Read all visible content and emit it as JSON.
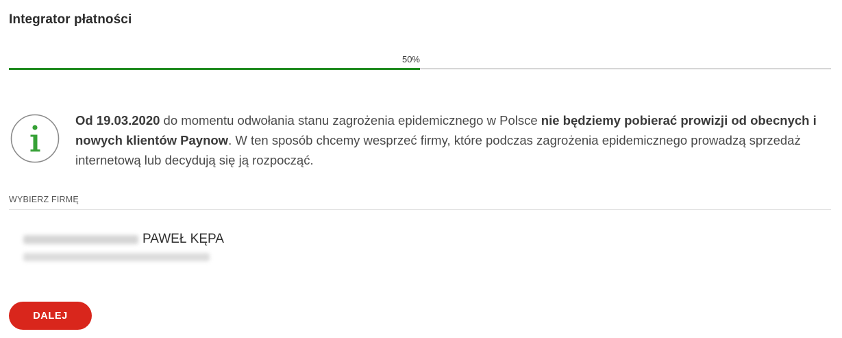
{
  "page": {
    "title": "Integrator płatności"
  },
  "progress": {
    "label": "50%",
    "value": 0.5,
    "fill_color": "#1e8a1e",
    "track_color": "#9a9a9a"
  },
  "notice": {
    "icon": "info-icon",
    "icon_color": "#35a035",
    "date_bold": "Od 19.03.2020",
    "text_1": " do momentu odwołania stanu zagrożenia epidemicznego w Polsce ",
    "bold_2": "nie będziemy pobierać prowizji od obecnych i nowych klientów Paynow",
    "text_2": ". W ten sposób chcemy wesprzeć firmy, które podczas zagrożenia epidemicznego prowadzą sprzedaż internetową lub decydują się ją rozpocząć."
  },
  "company_section": {
    "label": "WYBIERZ FIRMĘ",
    "companies": [
      {
        "name": "PAWEŁ KĘPA"
      }
    ]
  },
  "actions": {
    "next_label": "DALEJ",
    "next_color": "#d9261c"
  }
}
